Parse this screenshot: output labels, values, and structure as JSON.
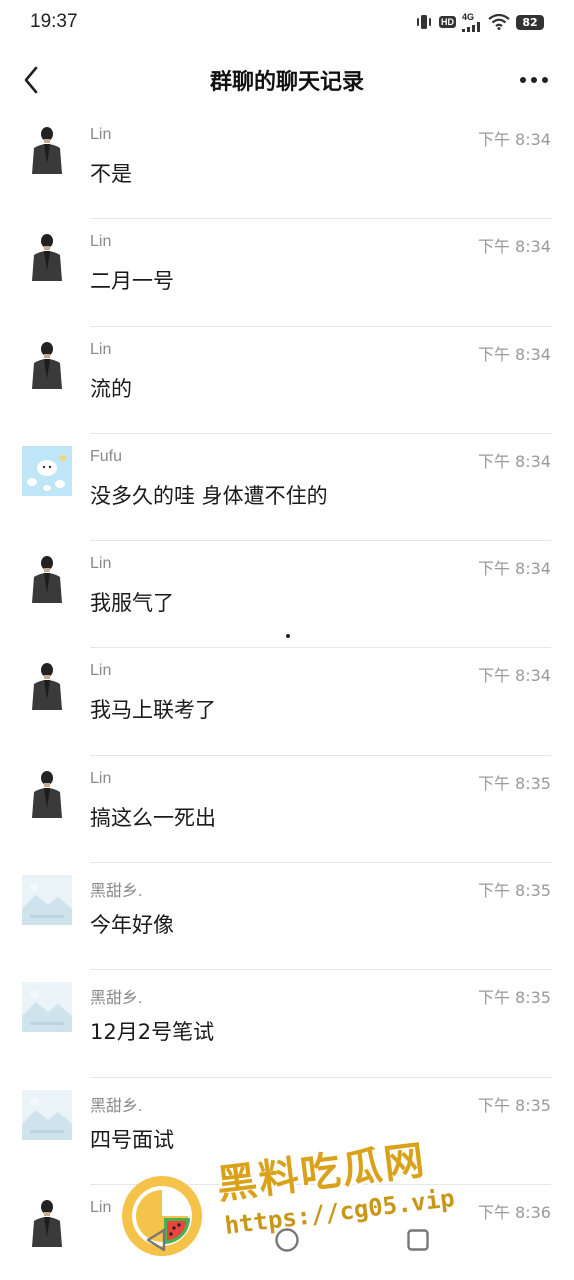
{
  "status_bar": {
    "time": "19:37",
    "hd": "HD",
    "network": "4G",
    "battery": "82"
  },
  "header": {
    "title": "群聊的聊天记录",
    "back_icon": "chevron-left-icon",
    "more_icon": "more-dots-icon"
  },
  "messages": [
    {
      "sender": "Lin",
      "time": "下午 8:34",
      "text": "不是",
      "avatar": "dark-suit"
    },
    {
      "sender": "Lin",
      "time": "下午 8:34",
      "text": "二月一号",
      "avatar": "dark-suit"
    },
    {
      "sender": "Lin",
      "time": "下午 8:34",
      "text": "流的",
      "avatar": "dark-suit"
    },
    {
      "sender": "Fufu",
      "time": "下午 8:34",
      "text": "没多久的哇 身体遭不住的",
      "avatar": "cartoon-blue"
    },
    {
      "sender": "Lin",
      "time": "下午 8:34",
      "text": "我服气了",
      "avatar": "dark-suit"
    },
    {
      "sender": "Lin",
      "time": "下午 8:34",
      "text": "我马上联考了",
      "avatar": "dark-suit"
    },
    {
      "sender": "Lin",
      "time": "下午 8:35",
      "text": "搞这么一死出",
      "avatar": "dark-suit"
    },
    {
      "sender": "黑甜乡.",
      "time": "下午 8:35",
      "text": "今年好像",
      "avatar": "landscape"
    },
    {
      "sender": "黑甜乡.",
      "time": "下午 8:35",
      "text": "12月2号笔试",
      "avatar": "landscape"
    },
    {
      "sender": "黑甜乡.",
      "time": "下午 8:35",
      "text": "四号面试",
      "avatar": "landscape"
    },
    {
      "sender": "Lin",
      "time": "下午 8:36",
      "text": "",
      "avatar": "dark-suit"
    }
  ],
  "watermark": {
    "title": "黑料吃瓜网",
    "url": "https://cg05.vip"
  },
  "nav_keys": {
    "back": "triangle-back-icon",
    "home": "circle-home-icon",
    "recents": "square-recents-icon"
  }
}
